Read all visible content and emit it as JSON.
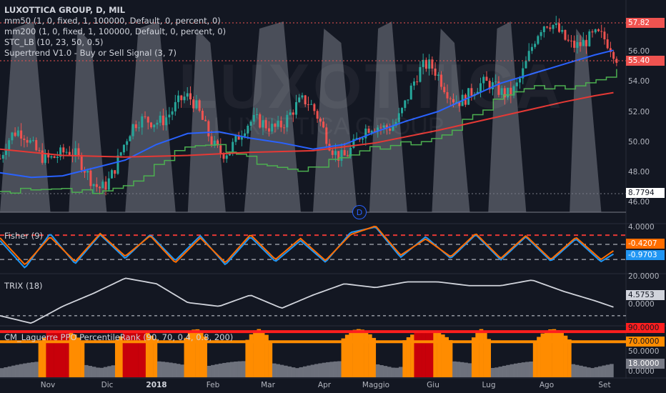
{
  "legend": {
    "title": "LUXOTTICA GROUP, D, MIL",
    "lines": [
      "mm50 (1, 0, fixed, 1, 100000, Default, 0, percent, 0)",
      "mm200 (1, 0, fixed, 1, 100000, Default, 0, percent, 0)",
      "STC_LB (10, 23, 50, 0.5)",
      "Supertrend V1.0 - Buy or Sell Signal (3, 7)"
    ]
  },
  "watermark": {
    "line1": "LUXOTTICA",
    "line2": "LUXOTTICA GROUP"
  },
  "badge": "D",
  "x_labels": [
    "Nov",
    "Dic",
    "2018",
    "Feb",
    "Mar",
    "Apr",
    "Maggio",
    "Giu",
    "Lug",
    "Ago",
    "Set"
  ],
  "chart_data": [
    {
      "type": "candlestick",
      "title": "LUXOTTICA GROUP, D, MIL",
      "y_ticks": [
        "46.00",
        "48.00",
        "50.00",
        "52.00",
        "54.00",
        "56.00"
      ],
      "ylim": [
        45.3,
        59.5
      ],
      "price_labels": [
        {
          "value": "57.82",
          "color": "#ef5350"
        },
        {
          "value": "55.40",
          "color": "#ef5350"
        },
        {
          "value": "8.7794",
          "color": "#131722"
        }
      ],
      "series": [
        {
          "name": "mm50",
          "color": "#2962ff",
          "x": [
            0,
            0.05,
            0.1,
            0.15,
            0.2,
            0.25,
            0.3,
            0.35,
            0.4,
            0.45,
            0.5,
            0.55,
            0.6,
            0.65,
            0.7,
            0.75,
            0.8,
            0.85,
            0.9,
            0.95,
            0.98
          ],
          "values": [
            48.5,
            48.2,
            48.3,
            48.8,
            49.3,
            50.3,
            51.0,
            51.1,
            50.7,
            50.4,
            50.0,
            50.3,
            51.1,
            51.8,
            52.4,
            53.3,
            54.2,
            54.8,
            55.4,
            56.0,
            56.3
          ]
        },
        {
          "name": "mm200",
          "color": "#e53935",
          "x": [
            0,
            0.1,
            0.2,
            0.3,
            0.4,
            0.5,
            0.6,
            0.7,
            0.8,
            0.9,
            0.95,
            0.98
          ],
          "values": [
            50.0,
            49.6,
            49.5,
            49.6,
            49.8,
            49.9,
            50.4,
            51.2,
            52.1,
            53.0,
            53.4,
            53.6
          ]
        }
      ]
    },
    {
      "type": "line",
      "title": "Fisher (9)",
      "y_ticks": [
        "4.0000"
      ],
      "ylim": [
        -4.5,
        4.5
      ],
      "price_labels": [
        {
          "value": "-0.4207",
          "color": "#ff6d00"
        },
        {
          "value": "-0.9703",
          "color": "#2196f3"
        }
      ],
      "reference_lines": [
        2.5,
        0.8,
        -2.0
      ],
      "series": [
        {
          "name": "fisher",
          "color": "#2196f3",
          "x": [
            0,
            0.04,
            0.08,
            0.12,
            0.16,
            0.2,
            0.24,
            0.28,
            0.32,
            0.36,
            0.4,
            0.44,
            0.48,
            0.52,
            0.56,
            0.6,
            0.64,
            0.68,
            0.72,
            0.76,
            0.8,
            0.84,
            0.88,
            0.92,
            0.96,
            0.98
          ],
          "values": [
            1.5,
            -3.6,
            2.8,
            -2.8,
            2.6,
            -1.8,
            2.6,
            -2.2,
            2.4,
            -3.0,
            2.2,
            -2.4,
            1.5,
            -2.5,
            3.0,
            4.0,
            -1.6,
            2.2,
            -1.8,
            2.6,
            -2.1,
            2.2,
            -2.3,
            1.8,
            -2.4,
            -1.0
          ]
        },
        {
          "name": "trigger",
          "color": "#ff6d00",
          "x": [
            0,
            0.04,
            0.08,
            0.12,
            0.16,
            0.2,
            0.24,
            0.28,
            0.32,
            0.36,
            0.4,
            0.44,
            0.48,
            0.52,
            0.56,
            0.6,
            0.64,
            0.68,
            0.72,
            0.76,
            0.8,
            0.84,
            0.88,
            0.92,
            0.96,
            0.98
          ],
          "values": [
            2.0,
            -3.0,
            2.2,
            -2.4,
            2.8,
            -1.4,
            2.4,
            -2.6,
            2.0,
            -2.6,
            2.6,
            -2.0,
            1.9,
            -2.2,
            2.6,
            4.2,
            -1.2,
            1.8,
            -1.5,
            2.8,
            -1.8,
            2.4,
            -2.0,
            2.1,
            -2.0,
            -0.4
          ]
        }
      ]
    },
    {
      "type": "line",
      "title": "TRIX (18)",
      "y_ticks": [
        "20.0000",
        "0.0000"
      ],
      "ylim": [
        -5,
        22
      ],
      "price_labels": [
        {
          "value": "4.5753",
          "color": "#d1d4dc"
        }
      ],
      "series": [
        {
          "name": "TRIX",
          "color": "#d1d4dc",
          "x": [
            0,
            0.05,
            0.1,
            0.15,
            0.2,
            0.25,
            0.3,
            0.35,
            0.4,
            0.45,
            0.5,
            0.55,
            0.6,
            0.65,
            0.7,
            0.75,
            0.8,
            0.85,
            0.9,
            0.95,
            0.98
          ],
          "values": [
            0,
            -4,
            5,
            12,
            20,
            17,
            7,
            5,
            11,
            4,
            11,
            17,
            15,
            18,
            18,
            16,
            16,
            19,
            13,
            8,
            4.6
          ]
        }
      ]
    },
    {
      "type": "bar",
      "title": "CM_Laguerre PPO PercentileRank (90, 70, 0.4, 0.8, 200)",
      "y_ticks": [
        "90.0000",
        "70.0000",
        "50.0000",
        "18.0000",
        "0.0000"
      ],
      "ylim": [
        0,
        100
      ],
      "price_labels": [
        {
          "value": "90.0000",
          "color": "#ff1e1e"
        },
        {
          "value": "70.0000",
          "color": "#ff8c00"
        },
        {
          "value": "18.0000",
          "color": "#787b86"
        }
      ],
      "reference_lines": [
        90,
        70
      ]
    }
  ]
}
